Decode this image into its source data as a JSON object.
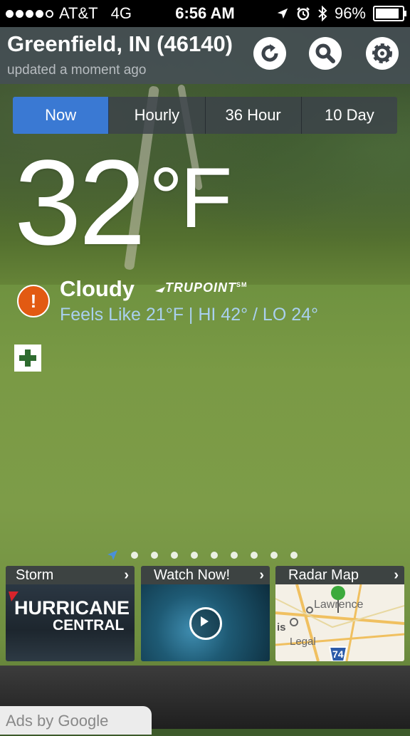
{
  "status_bar": {
    "carrier": "AT&T",
    "network": "4G",
    "time": "6:56 AM",
    "battery": "96%"
  },
  "header": {
    "location": "Greenfield, IN (46140)",
    "updated": "updated a moment ago"
  },
  "tabs": [
    {
      "label": "Now",
      "active": true
    },
    {
      "label": "Hourly",
      "active": false
    },
    {
      "label": "36 Hour",
      "active": false
    },
    {
      "label": "10 Day",
      "active": false
    }
  ],
  "current": {
    "temperature": "32",
    "unit": "°F",
    "condition": "Cloudy",
    "brand": "TRUPOINT",
    "brand_mark": "SM",
    "feels_like": "Feels Like 21°F | HI 42° / LO 24°"
  },
  "cards": [
    {
      "title": "Storm",
      "line1": "HURRICANE",
      "line2": "CENTRAL"
    },
    {
      "title": "Watch Now!"
    },
    {
      "title": "Radar Map",
      "map_labels": [
        "Lawrence",
        "Legal",
        "74",
        "is"
      ]
    }
  ],
  "ads": "Ads by Google",
  "colors": {
    "accent_tab": "#3a79d3",
    "feels_like": "#a9d0ef",
    "alert": "#e25a12"
  }
}
